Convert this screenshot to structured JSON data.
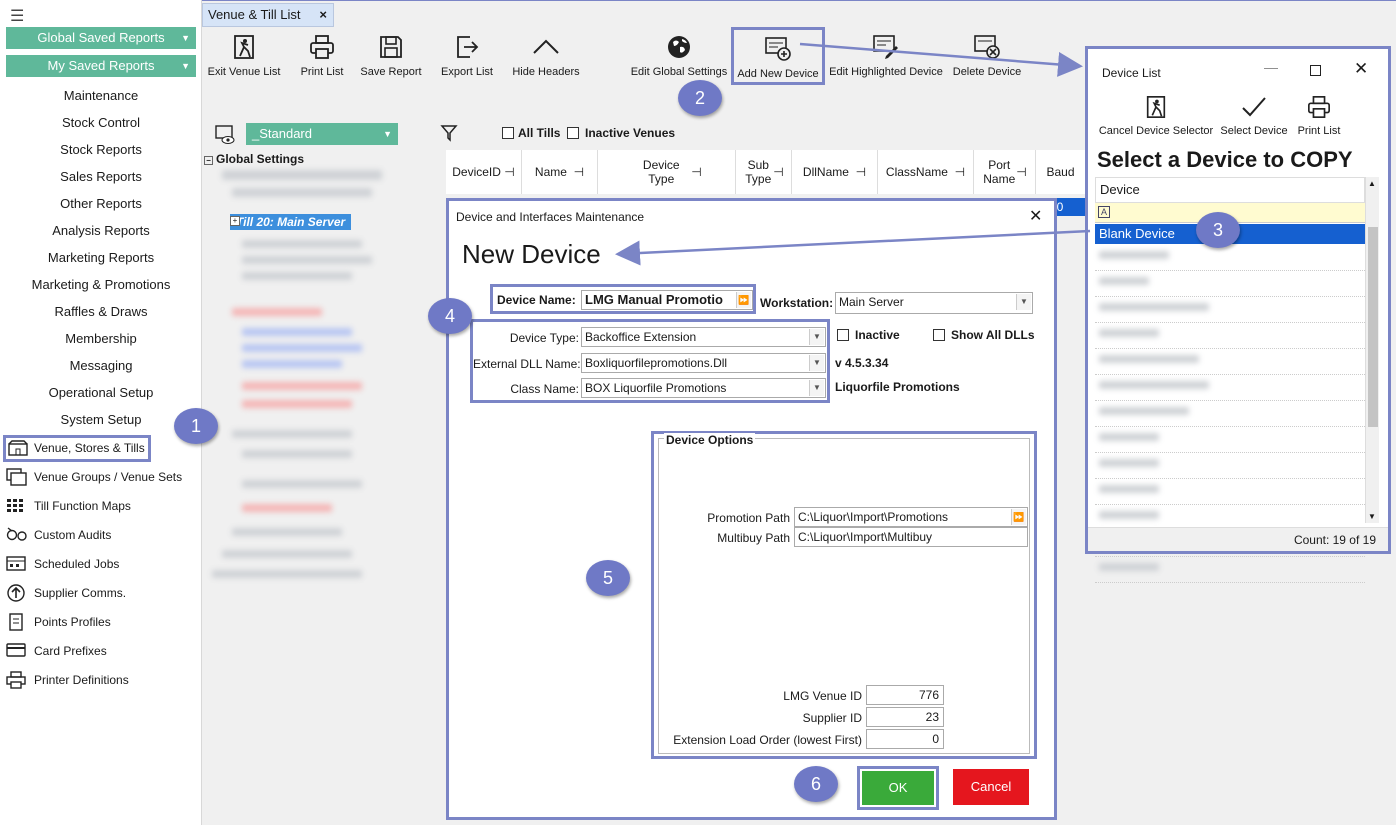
{
  "sidebar": {
    "global_saved": "Global Saved Reports",
    "my_saved": "My Saved Reports",
    "text_items": [
      "Maintenance",
      "Stock Control",
      "Stock Reports",
      "Sales Reports",
      "Other Reports",
      "Analysis Reports",
      "Marketing Reports",
      "Marketing & Promotions",
      "Raffles & Draws",
      "Membership",
      "Messaging",
      "Operational Setup",
      "System Setup"
    ],
    "icon_items": [
      {
        "label": "Venue, Stores & Tills",
        "icon": "shop-icon"
      },
      {
        "label": "Venue Groups / Venue Sets",
        "icon": "venue-groups-icon"
      },
      {
        "label": "Till Function Maps",
        "icon": "grid-icon"
      },
      {
        "label": "Custom Audits",
        "icon": "audit-icon"
      },
      {
        "label": "Scheduled Jobs",
        "icon": "calendar-icon"
      },
      {
        "label": "Supplier Comms.",
        "icon": "upload-icon"
      },
      {
        "label": "Points Profiles",
        "icon": "document-icon"
      },
      {
        "label": "Card Prefixes",
        "icon": "card-icon"
      },
      {
        "label": "Printer Definitions",
        "icon": "printer-icon"
      }
    ]
  },
  "tab": {
    "label": "Venue & Till List",
    "close": "×"
  },
  "toolbar": [
    "Exit Venue List",
    "Print List",
    "Save Report",
    "Export List",
    "Hide Headers",
    "Edit Global Settings",
    "Add New Device",
    "Edit Highlighted Device",
    "Delete Device"
  ],
  "filter": {
    "view": "_Standard",
    "all_tills": "All Tills",
    "inactive_venues": "Inactive Venues"
  },
  "tree": {
    "root": "Global Settings",
    "till": "Till 20: Main Server"
  },
  "grid": {
    "columns": [
      "DeviceID",
      "Name",
      "Device Type",
      "Sub Type",
      "DllName",
      "ClassName",
      "Port Name",
      "Baud"
    ],
    "partial_value": "00"
  },
  "device_list": {
    "title": "Device List",
    "buttons": [
      "Cancel Device Selector",
      "Select Device",
      "Print List"
    ],
    "heading": "Select a Device to COPY",
    "column": "Device",
    "filter_glyph": "A",
    "selected": "Blank Device",
    "count": "Count: 19 of 19"
  },
  "dialog": {
    "title": "Device and Interfaces Maintenance",
    "heading": "New Device",
    "device_name_label": "Device Name:",
    "device_name": "LMG Manual Promotio",
    "workstation_label": "Workstation:",
    "workstation": "Main Server",
    "device_type_label": "Device Type:",
    "device_type": "Backoffice Extension",
    "inactive": "Inactive",
    "show_all": "Show All DLLs",
    "dll_label": "External DLL Name:",
    "dll": "Boxliquorfilepromotions.Dll",
    "version": "v 4.5.3.34",
    "class_label": "Class Name:",
    "class": "BOX Liquorfile Promotions",
    "class_desc": "Liquorfile Promotions",
    "options_title": "Device Options",
    "promo_label": "Promotion Path",
    "promo": "C:\\Liquor\\Import\\Promotions",
    "multi_label": "Multibuy Path",
    "multi": "C:\\Liquor\\Import\\Multibuy",
    "venue_label": "LMG Venue ID",
    "venue": "776",
    "supplier_label": "Supplier ID",
    "supplier": "23",
    "order_label": "Extension Load Order (lowest First)",
    "order": "0",
    "ok": "OK",
    "cancel": "Cancel"
  },
  "badges": [
    "1",
    "2",
    "3",
    "4",
    "5",
    "6"
  ],
  "colors": {
    "accent": "#7b85c6",
    "green": "#5fb89a",
    "ok": "#3aaa3a",
    "cancel": "#e5161e",
    "select": "#1560d0"
  }
}
